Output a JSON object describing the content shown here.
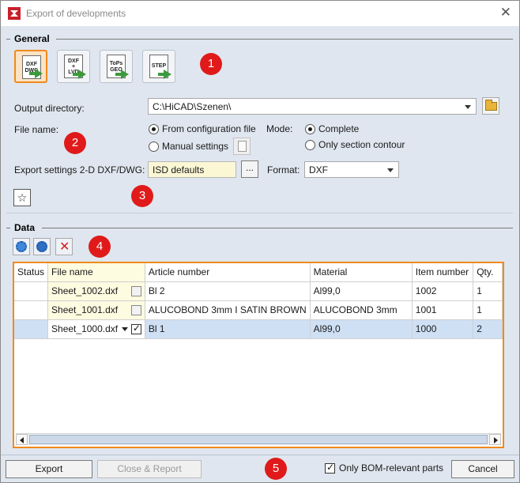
{
  "window": {
    "title": "Export of developments",
    "close_symbol": "✕"
  },
  "general": {
    "section_title": "General",
    "toolbar": [
      {
        "lines": [
          "DXF",
          "DWG"
        ],
        "active": true,
        "icon": "dxf-dwg-export-icon"
      },
      {
        "lines": [
          "DXF",
          "+",
          "LVD"
        ],
        "active": false,
        "icon": "dxf-lvd-export-icon"
      },
      {
        "lines": [
          "ToPs",
          "GEO"
        ],
        "active": false,
        "icon": "tops-geo-export-icon"
      },
      {
        "lines": [
          "STEP"
        ],
        "active": false,
        "icon": "step-export-icon"
      }
    ],
    "output_directory_label": "Output directory:",
    "output_directory_value": "C:\\HiCAD\\Szenen\\",
    "file_name_label": "File name:",
    "file_name_options": [
      "From configuration file",
      "Manual settings"
    ],
    "file_name_selected": 0,
    "mode_label": "Mode:",
    "mode_options": [
      "Complete",
      "Only section contour"
    ],
    "mode_selected": 0,
    "export_settings_label": "Export settings 2-D DXF/DWG:",
    "export_settings_value": "ISD defaults",
    "browse_label": "...",
    "format_label": "Format:",
    "format_value": "DXF",
    "favorite_symbol": "☆"
  },
  "data": {
    "section_title": "Data",
    "columns": [
      "Status",
      "File name",
      "Article number",
      "Material",
      "Item number",
      "Qty."
    ],
    "rows": [
      {
        "status": "",
        "file_name": "Sheet_1002.dxf",
        "checked": false,
        "article": "Bl 2",
        "material": "Al99,0",
        "item": "1002",
        "qty": "1"
      },
      {
        "status": "",
        "file_name": "Sheet_1001.dxf",
        "checked": false,
        "article": "ALUCOBOND 3mm I SATIN BROWN",
        "material": "ALUCOBOND 3mm",
        "item": "1001",
        "qty": "1"
      },
      {
        "status": "",
        "file_name": "Sheet_1000.dxf",
        "checked": true,
        "article": "Bl 1",
        "material": "Al99,0",
        "item": "1000",
        "qty": "2"
      }
    ]
  },
  "footer": {
    "export_label": "Export",
    "close_report_label": "Close & Report",
    "only_bom_label": "Only BOM-relevant parts",
    "cancel_label": "Cancel"
  },
  "callouts": [
    "1",
    "2",
    "3",
    "4",
    "5"
  ],
  "colors": {
    "accent_orange": "#f08a1c",
    "callout_red": "#e01a1a",
    "dialog_bg": "#dfe6ef",
    "selection_blue": "#cfe0f5",
    "field_yellow": "#fbf7d4"
  }
}
